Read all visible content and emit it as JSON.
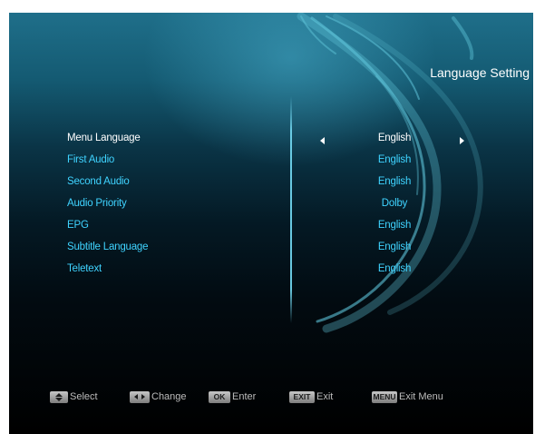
{
  "header": {
    "title": "Language Setting"
  },
  "menu": {
    "items": [
      {
        "label": "Menu Language",
        "value": "English",
        "selected": true
      },
      {
        "label": "First Audio",
        "value": "English"
      },
      {
        "label": "Second Audio",
        "value": "English"
      },
      {
        "label": "Audio Priority",
        "value": "Dolby"
      },
      {
        "label": "EPG",
        "value": "English"
      },
      {
        "label": "Subtitle Language",
        "value": "English"
      },
      {
        "label": "Teletext",
        "value": "English"
      }
    ]
  },
  "footer": {
    "select": {
      "key": "up-down-icon",
      "label": "Select"
    },
    "change": {
      "key": "left-right-icon",
      "label": "Change"
    },
    "enter": {
      "key": "OK",
      "label": "Enter"
    },
    "exit": {
      "key": "EXIT",
      "label": "Exit"
    },
    "menu": {
      "key": "MENU",
      "label": "Exit Menu"
    }
  },
  "colors": {
    "item_text": "#3fd3ff",
    "selected_text": "#ffffff",
    "background_top": "#1f6f8a",
    "background_bottom": "#000000"
  }
}
